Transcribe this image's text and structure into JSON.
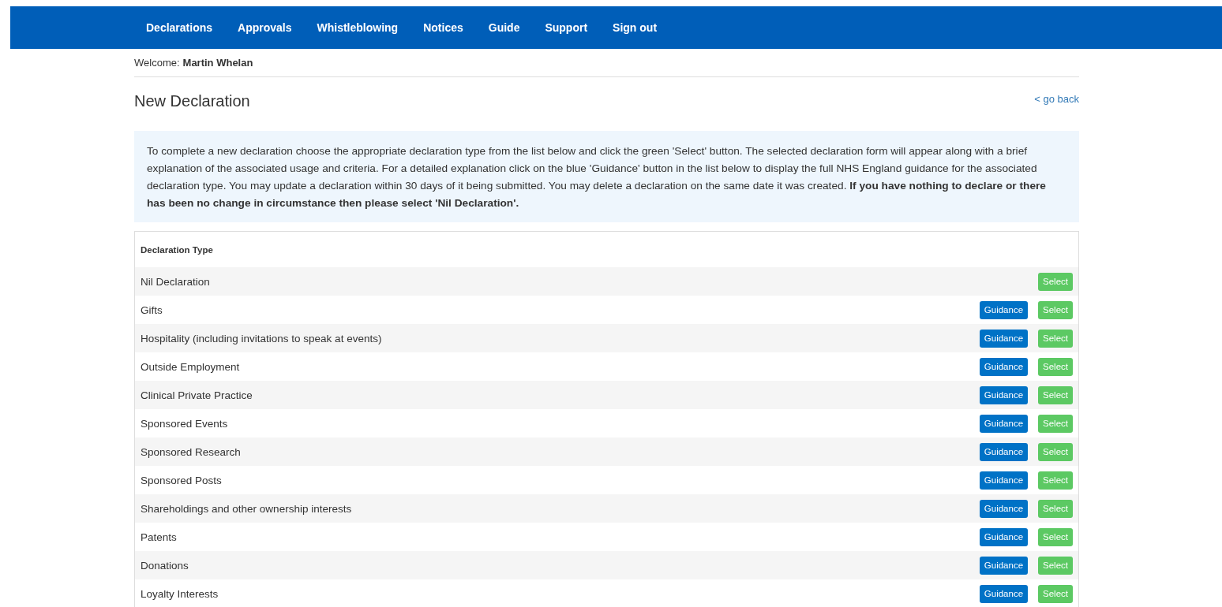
{
  "nav": [
    {
      "label": "Declarations"
    },
    {
      "label": "Approvals"
    },
    {
      "label": "Whistleblowing"
    },
    {
      "label": "Notices"
    },
    {
      "label": "Guide"
    },
    {
      "label": "Support"
    },
    {
      "label": "Sign out"
    }
  ],
  "welcome": {
    "label": "Welcome:",
    "name": "Martin Whelan"
  },
  "title": "New Declaration",
  "back_link": "< go back",
  "info": "To complete a new declaration choose the appropriate declaration type from the list below and click the green 'Select' button. The selected declaration form will appear along with a brief explanation of the associated usage and criteria. For a detailed explanation click on the blue 'Guidance' button in the list below to display the full NHS England guidance for the associated declaration type. You may update a declaration within 30 days of it being submitted. You may delete a declaration on the same date it was created. **If you have nothing to declare or there has been no change in circumstance then please select 'Nil Declaration'.**",
  "table": {
    "header": "Declaration Type",
    "rows": [
      {
        "name": "Nil Declaration",
        "select": "Select"
      },
      {
        "name": "Gifts",
        "guidance": "Guidance",
        "select": "Select"
      },
      {
        "name": "Hospitality (including invitations to speak at events)",
        "guidance": "Guidance",
        "select": "Select"
      },
      {
        "name": "Outside Employment",
        "guidance": "Guidance",
        "select": "Select"
      },
      {
        "name": "Clinical Private Practice",
        "guidance": "Guidance",
        "select": "Select"
      },
      {
        "name": "Sponsored Events",
        "guidance": "Guidance",
        "select": "Select"
      },
      {
        "name": "Sponsored Research",
        "guidance": "Guidance",
        "select": "Select"
      },
      {
        "name": "Sponsored Posts",
        "guidance": "Guidance",
        "select": "Select"
      },
      {
        "name": "Shareholdings and other ownership interests",
        "guidance": "Guidance",
        "select": "Select"
      },
      {
        "name": "Patents",
        "guidance": "Guidance",
        "select": "Select"
      },
      {
        "name": "Donations",
        "guidance": "Guidance",
        "select": "Select"
      },
      {
        "name": "Loyalty Interests",
        "guidance": "Guidance",
        "select": "Select"
      }
    ]
  }
}
